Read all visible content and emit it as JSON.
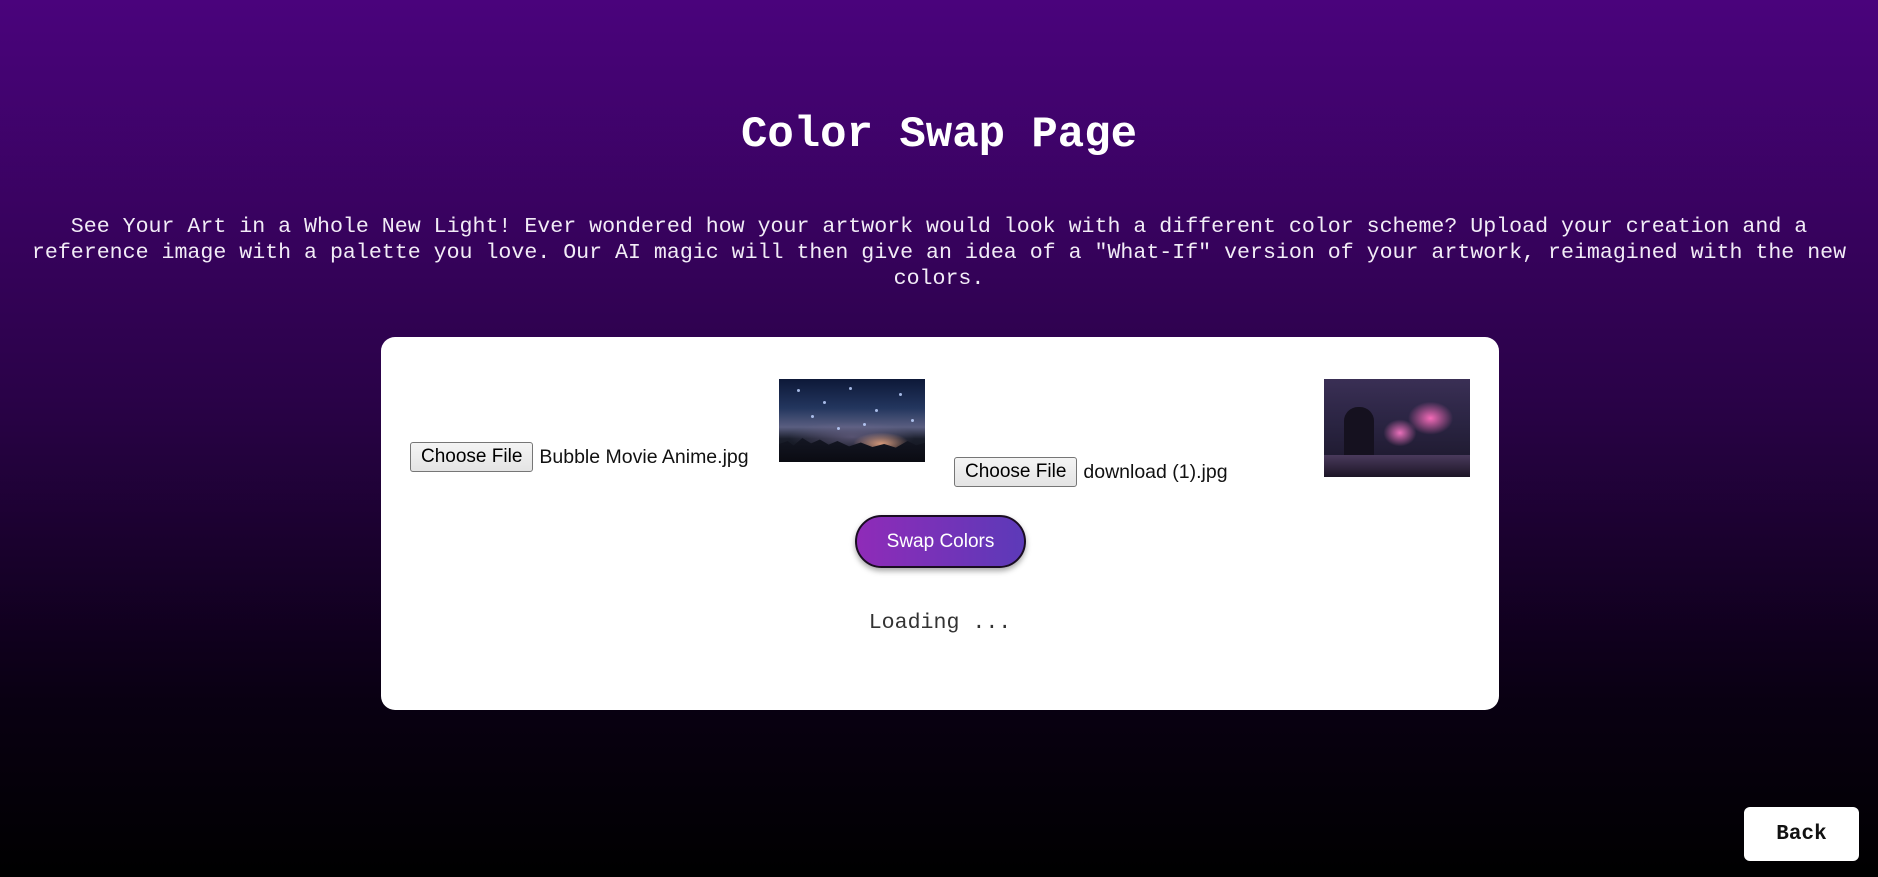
{
  "page": {
    "title": "Color Swap Page",
    "description": "See Your Art in a Whole New Light! Ever wondered how your artwork would look with a different color scheme? Upload your creation and a reference image with a palette you love. Our AI magic will then give an idea of a \"What-If\" version of your artwork, reimagined with the new colors."
  },
  "upload": {
    "artwork": {
      "button_label": "Choose File",
      "file_name": "Bubble Movie Anime.jpg"
    },
    "reference": {
      "button_label": "Choose File",
      "file_name": "download (1).jpg"
    }
  },
  "actions": {
    "swap_label": "Swap Colors",
    "back_label": "Back"
  },
  "status": {
    "text": "Loading ..."
  },
  "icons": {
    "artwork_preview": "anime-night-cityscape-image",
    "reference_preview": "neon-pink-gamer-room-image"
  },
  "colors": {
    "background_top": "#4a037c",
    "background_bottom": "#000000",
    "swap_button_start": "#8f2bb8",
    "swap_button_end": "#5c3ab8",
    "card": "#ffffff"
  }
}
